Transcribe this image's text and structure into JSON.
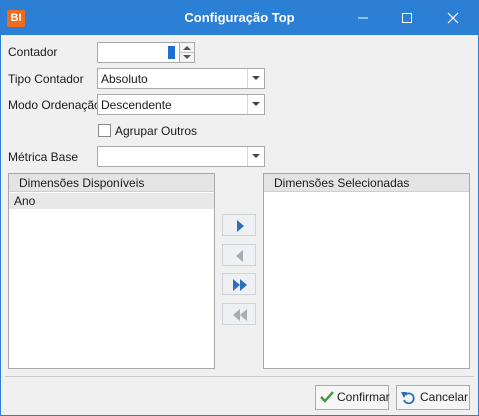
{
  "window": {
    "title": "Configuração Top",
    "app_icon_text": "BI",
    "accent_color": "#2b7fd4"
  },
  "form": {
    "contador_label": "Contador",
    "contador_value": "",
    "tipo_label": "Tipo Contador",
    "tipo_value": "Absoluto",
    "modo_label": "Modo Ordenação",
    "modo_value": "Descendente",
    "agrupar_label": "Agrupar Outros",
    "agrupar_checked": false,
    "metrica_label": "Métrica Base",
    "metrica_value": ""
  },
  "lists": {
    "available_title": "Dimensões Disponíveis",
    "available_items": [
      "Ano"
    ],
    "selected_title": "Dimensões Selecionadas",
    "selected_items": []
  },
  "transfer_buttons": [
    "move-right-icon",
    "move-left-icon",
    "move-all-right-icon",
    "move-all-left-icon"
  ],
  "footer": {
    "confirm_label": "Confirmar",
    "cancel_label": "Cancelar"
  }
}
